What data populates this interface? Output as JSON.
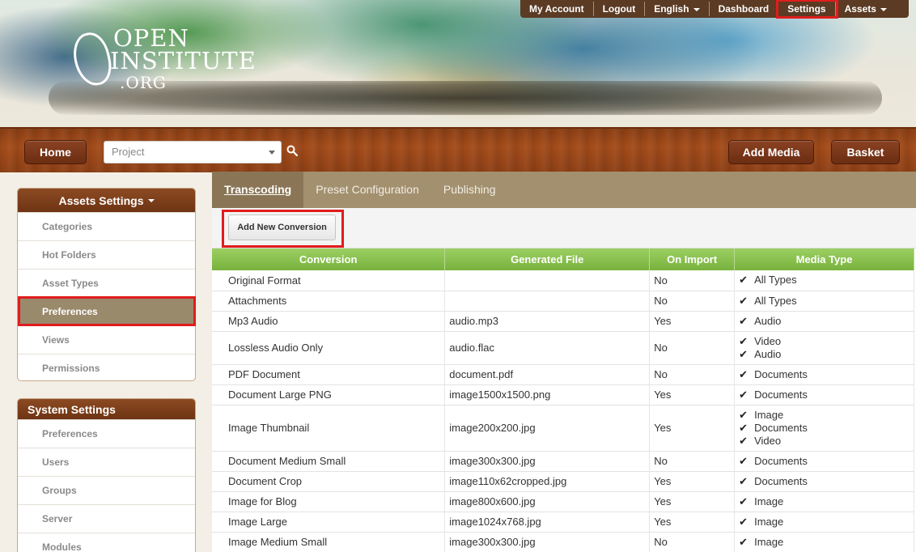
{
  "brand": {
    "logo_line1": "OPEN",
    "logo_line2": "INSTITUTE",
    "logo_line3": ".ORG"
  },
  "topnav": {
    "my_account": "My Account",
    "logout": "Logout",
    "language": "English",
    "dashboard": "Dashboard",
    "settings": "Settings",
    "assets": "Assets"
  },
  "toolbar": {
    "home": "Home",
    "project_placeholder": "Project",
    "add_media": "Add Media",
    "basket": "Basket"
  },
  "assets_settings": {
    "title": "Assets Settings",
    "items": [
      "Categories",
      "Hot Folders",
      "Asset Types",
      "Preferences",
      "Views",
      "Permissions"
    ],
    "active": "Preferences"
  },
  "system_settings": {
    "title": "System Settings",
    "items": [
      "Preferences",
      "Users",
      "Groups",
      "Server",
      "Modules"
    ]
  },
  "tabs": [
    "Transcoding",
    "Preset Configuration",
    "Publishing"
  ],
  "active_tab": "Transcoding",
  "add_conversion_label": "Add New Conversion",
  "table": {
    "headers": [
      "Conversion",
      "Generated File",
      "On Import",
      "Media Type"
    ],
    "rows": [
      {
        "conversion": "Original Format",
        "file": "",
        "on_import": "No",
        "media": [
          "All Types"
        ]
      },
      {
        "conversion": "Attachments",
        "file": "",
        "on_import": "No",
        "media": [
          "All Types"
        ]
      },
      {
        "conversion": "Mp3 Audio",
        "file": "audio.mp3",
        "on_import": "Yes",
        "media": [
          "Audio"
        ]
      },
      {
        "conversion": "Lossless Audio Only",
        "file": "audio.flac",
        "on_import": "No",
        "media": [
          "Video",
          "Audio"
        ]
      },
      {
        "conversion": "PDF Document",
        "file": "document.pdf",
        "on_import": "No",
        "media": [
          "Documents"
        ]
      },
      {
        "conversion": "Document Large PNG",
        "file": "image1500x1500.png",
        "on_import": "Yes",
        "media": [
          "Documents"
        ]
      },
      {
        "conversion": "Image Thumbnail",
        "file": "image200x200.jpg",
        "on_import": "Yes",
        "media": [
          "Image",
          "Documents",
          "Video"
        ]
      },
      {
        "conversion": "Document Medium Small",
        "file": "image300x300.jpg",
        "on_import": "No",
        "media": [
          "Documents"
        ]
      },
      {
        "conversion": "Document Crop",
        "file": "image110x62cropped.jpg",
        "on_import": "Yes",
        "media": [
          "Documents"
        ]
      },
      {
        "conversion": "Image for Blog",
        "file": "image800x600.jpg",
        "on_import": "Yes",
        "media": [
          "Image"
        ]
      },
      {
        "conversion": "Image Large",
        "file": "image1024x768.jpg",
        "on_import": "Yes",
        "media": [
          "Image"
        ]
      },
      {
        "conversion": "Image Medium Small",
        "file": "image300x300.jpg",
        "on_import": "No",
        "media": [
          "Image"
        ]
      }
    ]
  },
  "colors": {
    "wood": "#a44c1a",
    "tab_bar": "#a2906f",
    "table_header": "#8cc451",
    "highlight": "#e01c1c"
  }
}
